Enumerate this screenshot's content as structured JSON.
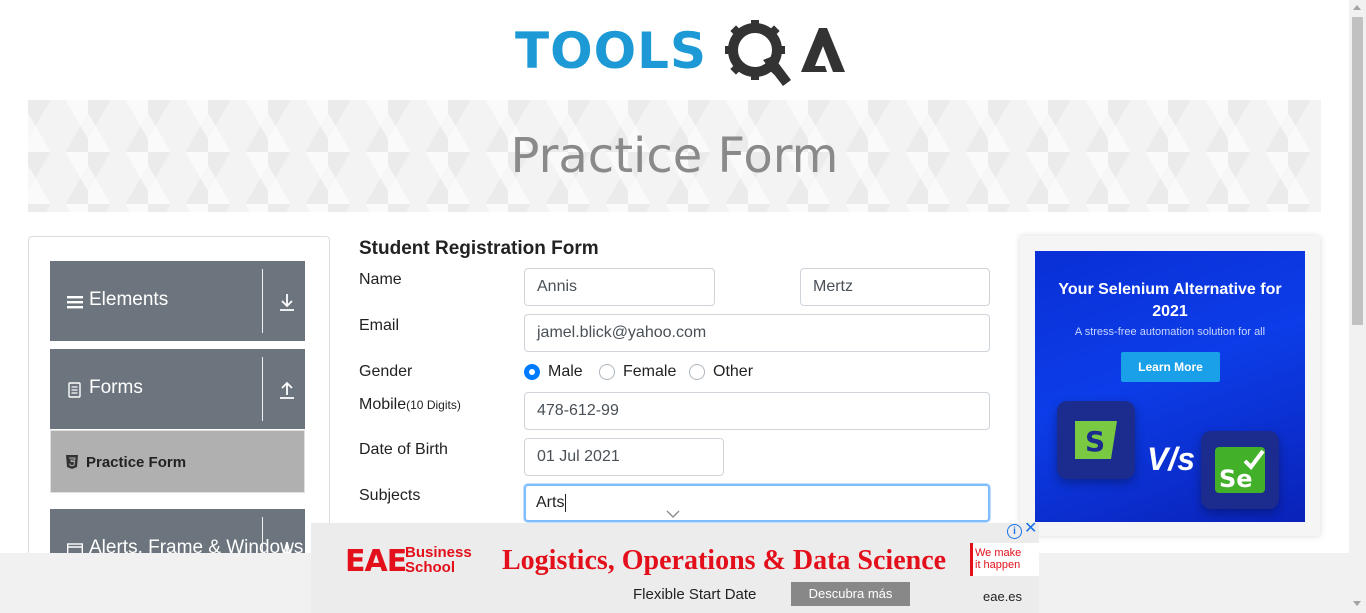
{
  "logo": {
    "text": "TOOLS",
    "suffix": "QA",
    "color_primary": "#1d9ad6",
    "color_secondary": "#333333"
  },
  "banner": {
    "title": "Practice Form"
  },
  "sidebar": {
    "groups": [
      {
        "label": "Elements",
        "icon": "menu-icon",
        "arrow": "download-arrow-icon"
      },
      {
        "label": "Forms",
        "icon": "document-icon",
        "arrow": "upload-arrow-icon"
      },
      {
        "label": "Alerts, Frame & Windows",
        "icon": "window-icon",
        "arrow": "download-arrow-icon"
      }
    ],
    "active_item": {
      "label": "Practice Form",
      "icon": "html5-icon"
    },
    "colors": {
      "group_bg": "#6c757d",
      "active_bg": "#b0b0b0"
    }
  },
  "form": {
    "title": "Student Registration Form",
    "name_label": "Name",
    "first_name": "Annis",
    "last_name": "Mertz",
    "email_label": "Email",
    "email": "jamel.blick@yahoo.com",
    "gender_label": "Gender",
    "gender_options": [
      "Male",
      "Female",
      "Other"
    ],
    "gender_selected": "Male",
    "mobile_label": "Mobile",
    "mobile_hint": "(10 Digits)",
    "mobile": "478-612-99",
    "dob_label": "Date of Birth",
    "dob": "01 Jul 2021",
    "subjects_label": "Subjects",
    "subjects": "Arts"
  },
  "side_ad": {
    "headline": "Your Selenium Alternative for 2021",
    "subline": "A stress-free automation solution for all",
    "button": "Learn More",
    "vs_text": "V/s",
    "logo_left": "S",
    "logo_right": "Se"
  },
  "bottom_ad": {
    "brand": "EAE",
    "brand_sub_1": "Business",
    "brand_sub_2": "School",
    "headline": "Logistics, Operations & Data Science",
    "tag_1": "We make",
    "tag_2": "it happen",
    "subline": "Flexible Start Date",
    "cta": "Descubra más",
    "domain": "eae.es",
    "accent": "#e3101b"
  }
}
